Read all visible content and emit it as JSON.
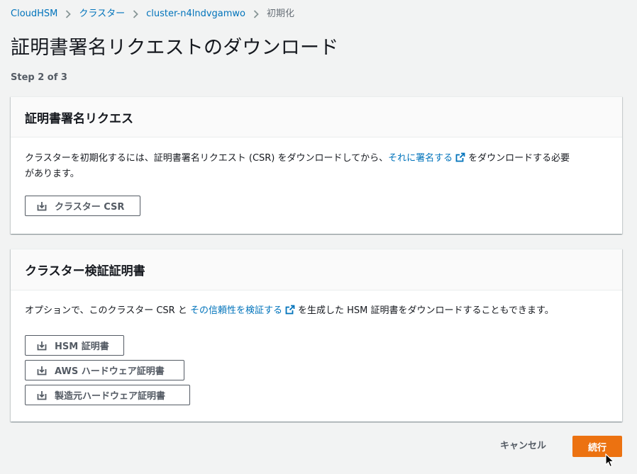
{
  "breadcrumb": {
    "items": [
      "CloudHSM",
      "クラスター",
      "cluster-n4lndvgamwo"
    ],
    "current": "初期化"
  },
  "page": {
    "title": "証明書署名リクエストのダウンロード",
    "step": "Step 2 of 3"
  },
  "csr_panel": {
    "title": "証明書署名リクエス",
    "text_before": "クラスターを初期化するには、証明書署名リクエスト (CSR) をダウンロードしてから、",
    "link": "それに署名する",
    "text_after_line1": "をダウンロードする必要",
    "text_line2": "があります。",
    "button": "クラスター CSR"
  },
  "verify_panel": {
    "title": "クラスター検証証明書",
    "text_before": "オプションで、このクラスター CSR と ",
    "link": "その信頼性を検証する",
    "text_after": "を生成した HSM 証明書をダウンロードすることもできます。",
    "buttons": [
      "HSM 証明書",
      "AWS ハードウェア証明書",
      "製造元ハードウェア証明書"
    ]
  },
  "footer": {
    "cancel": "キャンセル",
    "continue": "続行"
  },
  "colors": {
    "link": "#0073bb",
    "primary": "#ec7211",
    "background": "#f2f3f3"
  },
  "icons": {
    "separator": "chevron-right-icon",
    "external": "external-link-icon",
    "download": "download-icon",
    "cursor": "mouse-pointer-icon"
  }
}
